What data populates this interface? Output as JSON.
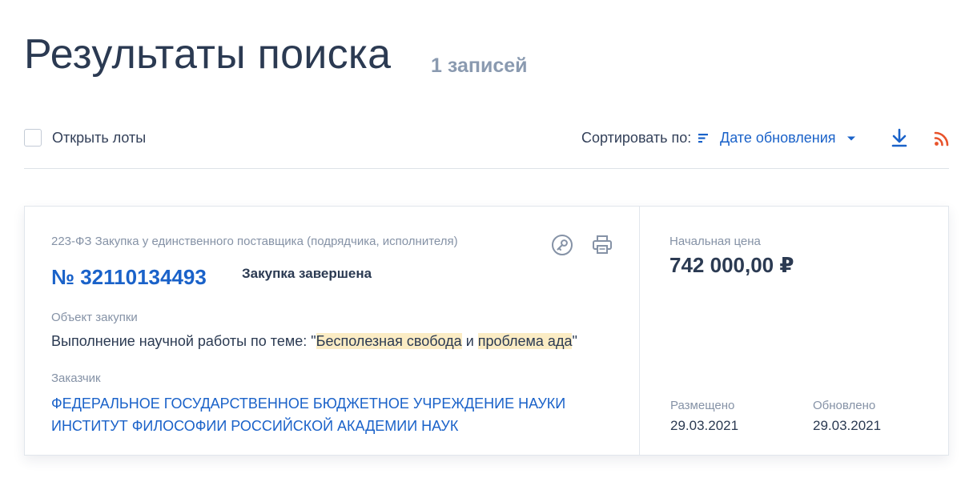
{
  "header": {
    "title": "Результаты поиска",
    "count": "1 записей"
  },
  "toolbar": {
    "open_lots_label": "Открыть лоты",
    "sort_label": "Сортировать по:",
    "sort_value": "Дате обновления",
    "icons": [
      "sort-icon",
      "chevron-down-icon",
      "download-icon",
      "rss-icon"
    ]
  },
  "result": {
    "law_type": "223-ФЗ Закупка у единственного поставщика (подрядчика, исполнителя)",
    "reg_number": "№ 32110134493",
    "status": "Закупка завершена",
    "subject_label": "Объект закупки",
    "subject": {
      "prefix": "Выполнение научной работы по теме: \"",
      "highlight1": "Бесполезная свобода",
      "middle": " и ",
      "highlight2": "проблема ада",
      "suffix": "\""
    },
    "customer_label": "Заказчик",
    "customer_line1": "ФЕДЕРАЛЬНОЕ ГОСУДАРСТВЕННОЕ БЮДЖЕТНОЕ УЧРЕЖДЕНИЕ НАУКИ",
    "customer_line2": "ИНСТИТУТ ФИЛОСОФИИ РОССИЙСКОЙ АКАДЕМИИ НАУК",
    "price_label": "Начальная цена",
    "price": "742 000,00 ₽",
    "posted_label": "Размещено",
    "posted_date": "29.03.2021",
    "updated_label": "Обновлено",
    "updated_date": "29.03.2021",
    "icons": [
      "key-icon",
      "print-icon"
    ]
  },
  "colors": {
    "accent": "#1a62c9",
    "text": "#2b3a52",
    "muted": "#8592a6",
    "highlight": "#fbecc4",
    "rss": "#e8532b"
  }
}
